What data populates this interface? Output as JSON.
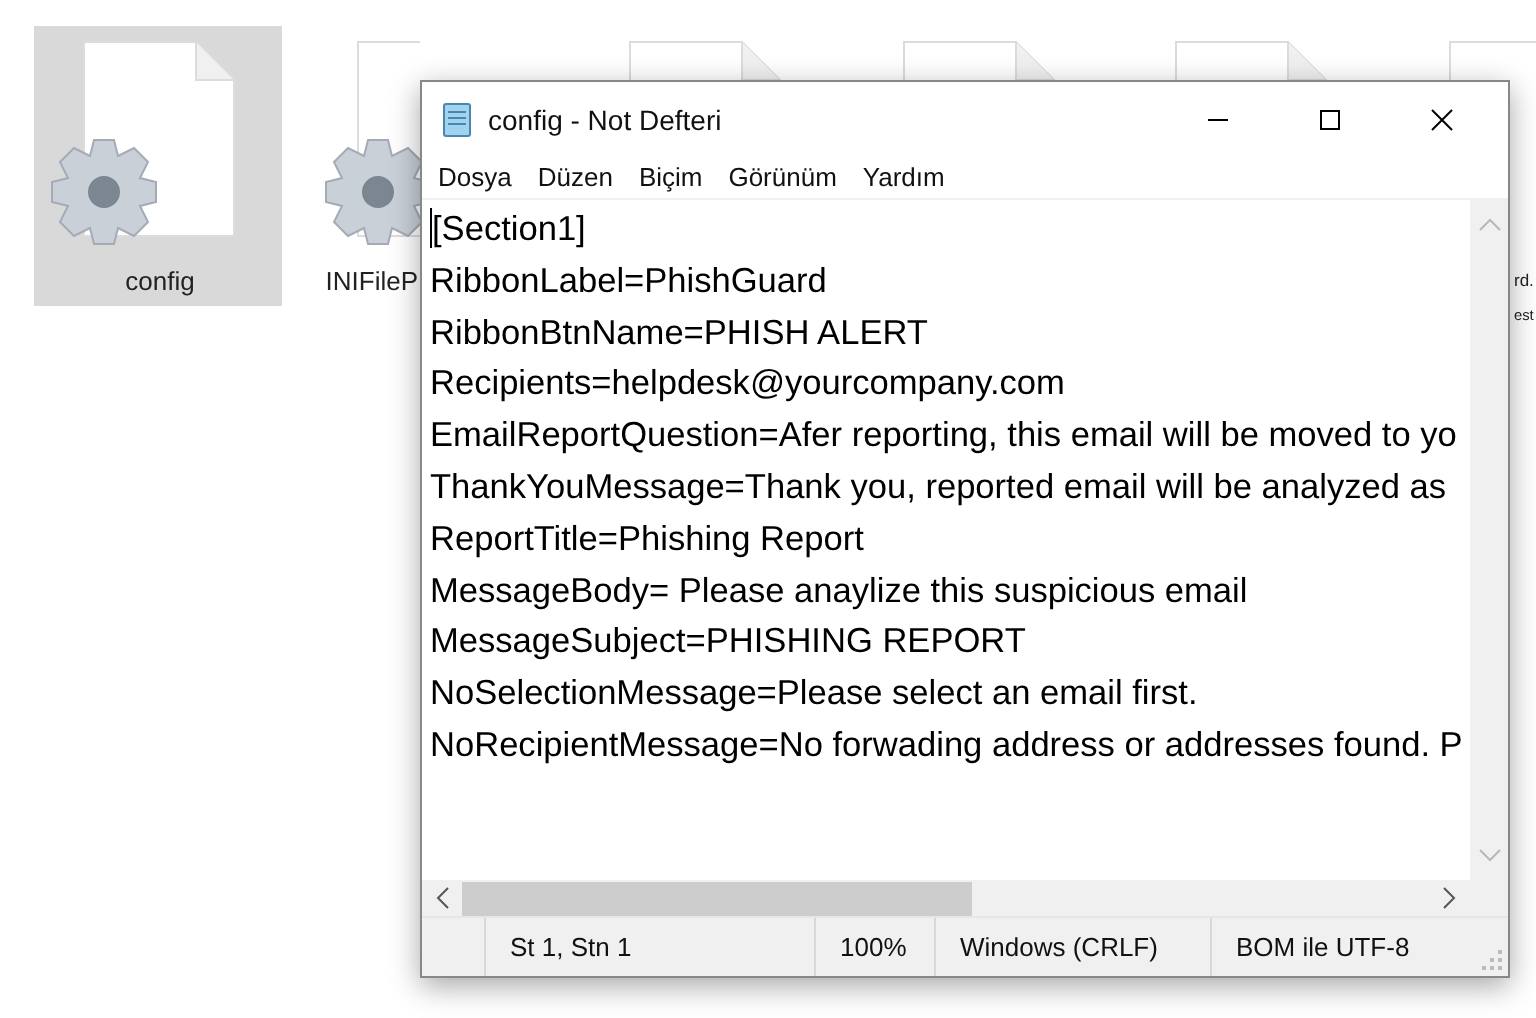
{
  "desktop": {
    "files": [
      {
        "label_lines": [
          "config"
        ],
        "selected": true
      },
      {
        "label_lines": [
          "INIFileP"
        ],
        "selected": false
      },
      {
        "selected": false
      },
      {
        "selected": false
      },
      {
        "selected": false
      },
      {
        "label_lines": [
          "rd.",
          "est"
        ],
        "selected": false
      }
    ]
  },
  "window": {
    "title": "config - Not Defteri",
    "menu": [
      "Dosya",
      "Düzen",
      "Biçim",
      "Görünüm",
      "Yardım"
    ],
    "lines": [
      "[Section1]",
      "RibbonLabel=PhishGuard",
      "RibbonBtnName=PHISH ALERT",
      "Recipients=helpdesk@yourcompany.com",
      "EmailReportQuestion=Afer reporting, this email will be moved to yo",
      "ThankYouMessage=Thank you, reported email will be analyzed as",
      "ReportTitle=Phishing Report",
      "MessageBody= Please anaylize this suspicious email",
      "MessageSubject=PHISHING REPORT",
      "NoSelectionMessage=Please select an email first.",
      "NoRecipientMessage=No forwading address or addresses found. P"
    ],
    "status_bar": [
      "St 1, Stn 1",
      "100%",
      "Windows (CRLF)",
      "BOM ile UTF-8"
    ]
  }
}
